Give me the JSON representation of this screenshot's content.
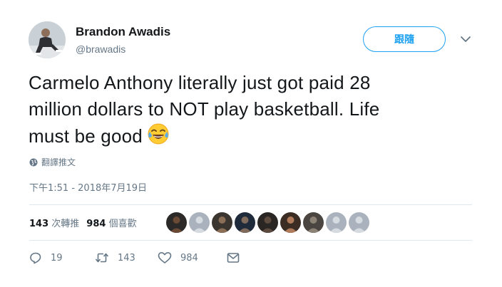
{
  "user": {
    "name": "Brandon Awadis",
    "handle": "@brawadis"
  },
  "follow_button": {
    "label": "跟隨"
  },
  "tweet": {
    "lines": [
      "Carmelo Anthony literally just got paid 28",
      "million dollars to NOT play basketball. Life",
      "must be good"
    ],
    "emoji": "face-with-tears-of-joy"
  },
  "translate": {
    "label": "翻譯推文"
  },
  "timestamp": "下午1:51 - 2018年7月19日",
  "stats": {
    "retweets_count": "143",
    "retweets_label": "次轉推",
    "likes_count": "984",
    "likes_label": "個喜歡"
  },
  "liker_avatars": [
    {
      "color": "#2b2a28",
      "face": "#6b4a35"
    },
    {
      "color": "#aab3bd",
      "face": "#d5dbe0"
    },
    {
      "color": "#3b3530",
      "face": "#8a6e56"
    },
    {
      "color": "#1f2a3a",
      "face": "#7f6a5b"
    },
    {
      "color": "#2a2624",
      "face": "#5e4b3f"
    },
    {
      "color": "#3c2d24",
      "face": "#b07b5a"
    },
    {
      "color": "#4a4540",
      "face": "#8c8276"
    },
    {
      "color": "#aab3bd",
      "face": "#d5dbe0"
    },
    {
      "color": "#aab3bd",
      "face": "#d5dbe0"
    }
  ],
  "actions": {
    "reply_count": "19",
    "retweet_count": "143",
    "like_count": "984"
  },
  "colors": {
    "accent": "#1da1f2",
    "secondary_text": "#657786",
    "divider": "#e1e8ed"
  }
}
